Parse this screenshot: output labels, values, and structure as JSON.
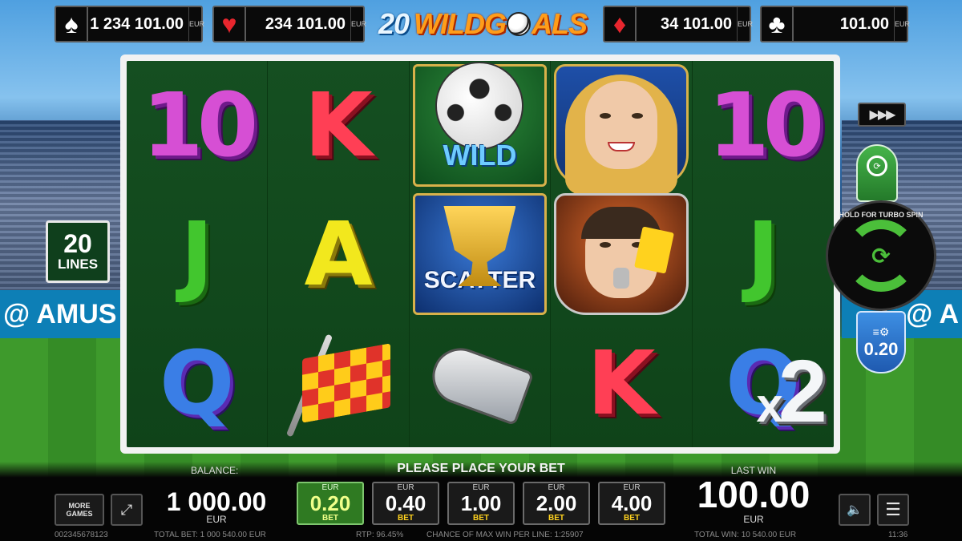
{
  "jackpots": [
    {
      "suit_icon": "♠",
      "amount": "1 234 101.00",
      "currency": "EUR",
      "color": "#ffffff"
    },
    {
      "suit_icon": "♥",
      "amount": "234 101.00",
      "currency": "EUR",
      "color": "#e8262e"
    },
    {
      "suit_icon": "♦",
      "amount": "34 101.00",
      "currency": "EUR",
      "color": "#e8262e"
    },
    {
      "suit_icon": "♣",
      "amount": "101.00",
      "currency": "EUR",
      "color": "#ffffff"
    }
  ],
  "logo": {
    "number": "20",
    "word_a": "WILD",
    "word_b": "G",
    "word_c": "ALS"
  },
  "lines_badge": {
    "number": "20",
    "label": "LINES"
  },
  "reels": {
    "col1": [
      "10",
      "J",
      "Q"
    ],
    "col2": [
      "K",
      "A",
      "flag"
    ],
    "col3": [
      "WILD",
      "SCATTER",
      "whistle"
    ],
    "col4": [
      "fan",
      "referee",
      "K"
    ],
    "col5": [
      "10",
      "J",
      "Q"
    ]
  },
  "multiplier": {
    "prefix": "x",
    "value": "2"
  },
  "controls": {
    "turbo_icon": "▶▶▶",
    "autoplay_icon": "⟳",
    "spin_hint": "HOLD FOR TURBO SPIN",
    "spin_icon": "⟳",
    "bet_lines_icon": "≡⚙",
    "bet_per_line": "0.20",
    "sound_icon": "🔈",
    "menu_icon": "☰",
    "more_games_line1": "MORE",
    "more_games_line2": "GAMES",
    "fullscreen_icon": "⤢"
  },
  "balance": {
    "label": "BALANCE:",
    "value": "1 000.00",
    "currency": "EUR"
  },
  "bet_prompt": "PLEASE PLACE YOUR BET",
  "bets": [
    {
      "currency": "EUR",
      "value": "0.20",
      "label": "BET",
      "selected": true
    },
    {
      "currency": "EUR",
      "value": "0.40",
      "label": "BET",
      "selected": false
    },
    {
      "currency": "EUR",
      "value": "1.00",
      "label": "BET",
      "selected": false
    },
    {
      "currency": "EUR",
      "value": "2.00",
      "label": "BET",
      "selected": false
    },
    {
      "currency": "EUR",
      "value": "4.00",
      "label": "BET",
      "selected": false
    }
  ],
  "last_win": {
    "label": "LAST WIN",
    "value": "100.00",
    "currency": "EUR"
  },
  "footer": {
    "ticket": "002345678123",
    "total_bet": "TOTAL BET: 1 000 540.00 EUR",
    "rtp": "RTP: 96.45%",
    "max_win": "CHANCE OF MAX WIN PER LINE: 1:25907",
    "total_win": "TOTAL WIN: 10 540.00 EUR",
    "time": "11:36"
  },
  "banner_text": {
    "left": "@ AMUS",
    "right": "S @ A"
  }
}
